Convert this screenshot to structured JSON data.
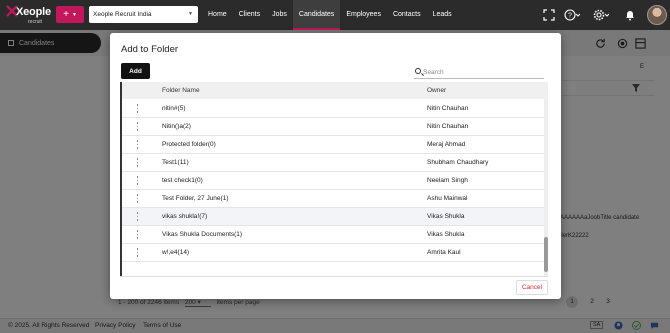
{
  "topbar": {
    "brand": "Xeople",
    "brand_sub": "recruit",
    "tenant": "Xeople Recruit India",
    "nav": [
      "Home",
      "Clients",
      "Jobs",
      "Candidates",
      "Employees",
      "Contacts",
      "Leads"
    ],
    "active_nav": "Candidates",
    "accent": "#c2185b",
    "icons": [
      "expand-icon",
      "help-icon",
      "settings-icon",
      "bell-icon",
      "avatar"
    ]
  },
  "page": {
    "section_tab": "Candidates",
    "pager_summary": "1 - 200 of 2246 items",
    "page_size": "200",
    "items_per_page": "items per page",
    "pages": [
      "1",
      "2",
      "3"
    ],
    "bg_snippets": {
      "r1": "AAAAAAaJoobTitle candidate",
      "r2": "ilerK22222",
      "col_e": "E",
      "badge": "SA"
    }
  },
  "footer": {
    "copyright": "© 2025. All Rights Reserved",
    "privacy": "Privacy Policy",
    "terms": "Terms of Use"
  },
  "modal": {
    "title": "Add to Folder",
    "add_label": "Add",
    "search_placeholder": "Search",
    "columns": {
      "folder": "Folder Name",
      "owner": "Owner"
    },
    "rows": [
      {
        "folder": "nitin#(5)",
        "owner": "Nitin Chauhan"
      },
      {
        "folder": "Nitin()a(2)",
        "owner": "Nitin Chauhan"
      },
      {
        "folder": "Protected folder(0)",
        "owner": "Meraj Ahmad"
      },
      {
        "folder": "Test1(11)",
        "owner": "Shubham Chaudhary"
      },
      {
        "folder": "test check1(0)",
        "owner": "Neelam Singh"
      },
      {
        "folder": "Test Folder, 27 June(1)",
        "owner": "Ashu Mainwal"
      },
      {
        "folder": "vikas shukla!(7)",
        "owner": "Vikas Shukla",
        "highlighted": true
      },
      {
        "folder": "Vikas Shukla Documents(1)",
        "owner": "Vikas Shukla"
      },
      {
        "folder": "w!,e4(14)",
        "owner": "Amrita Kaul"
      }
    ],
    "cancel_label": "Cancel"
  }
}
